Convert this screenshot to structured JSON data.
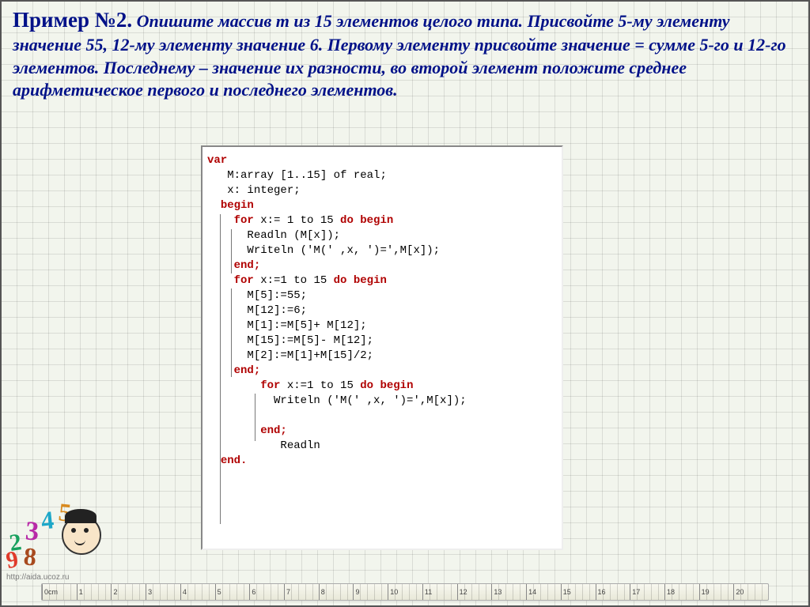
{
  "task": {
    "title": "Пример №2.",
    "body": "Опишите массив m из 15 элементов целого типа. Присвойте 5-му элементу значение 55, 12-му элементу значение 6. Первому элементу присвойте значение = сумме 5-го и 12-го элементов. Последнему – значение их разности, во второй элемент положите среднее арифметическое первого и последнего элементов."
  },
  "code": {
    "l01": "var",
    "l02": "M:array [1..15] of real;",
    "l03": "x: integer;",
    "l04": "begin",
    "l05": "for",
    "l05b": " x:= 1 to 15 ",
    "l05c": "do begin",
    "l06": "Readln (M[x]);",
    "l07": "Writeln ('M(' ,x, ')=',M[x]);",
    "l08": "end;",
    "l09": "for",
    "l09b": " x:=1 to 15 ",
    "l09c": "do begin",
    "l10": "M[5]:=55;",
    "l11": "M[12]:=6;",
    "l12": "M[1]:=M[5]+ M[12];",
    "l13": "M[15]:=M[5]- M[12];",
    "l14": "M[2]:=M[1]+M[15]/2;",
    "l15": "end;",
    "l16": "for",
    "l16b": " x:=1 to 15 ",
    "l16c": "do begin",
    "l17": "Writeln ('M(' ,x, ')=',M[x]);",
    "l18": "end;",
    "l19": "Readln",
    "l20": "end."
  },
  "ruler": [
    "0cm",
    "1",
    "2",
    "3",
    "4",
    "5",
    "6",
    "7",
    "8",
    "9",
    "10",
    "11",
    "12",
    "13",
    "14",
    "15",
    "16",
    "17",
    "18",
    "19",
    "20"
  ],
  "watermark": "http://aida.ucoz.ru"
}
